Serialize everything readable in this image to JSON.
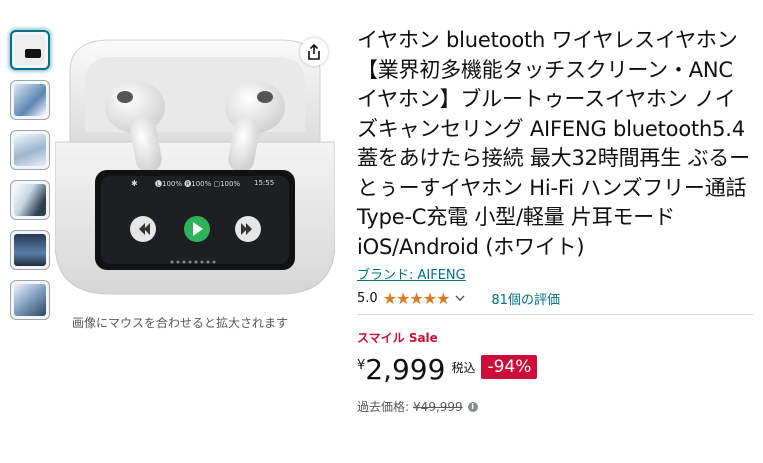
{
  "gallery": {
    "thumbnails": [
      "thumb-1",
      "thumb-2",
      "thumb-3",
      "thumb-4",
      "thumb-5",
      "thumb-6"
    ],
    "zoom_hint": "画像にマウスを合わせると拡大されます",
    "case_screen": {
      "bt_symbol": "✱",
      "status": "🅛100% 🅡100% ▢100%",
      "time": "15:55"
    }
  },
  "product": {
    "title": "イヤホン bluetooth ワイヤレスイヤホン【業界初多機能タッチスクリーン・ANC イヤホン】ブルートゥースイヤホン ノイズキャンセリング AIFENG bluetooth5.4 蓋をあけたら接続 最大32時間再生 ぶるーとぅーすイヤホン Hi-Fi ハンズフリー通話 Type-C充電 小型/軽量 片耳モード iOS/Android (ホワイト)",
    "brand": "ブランド: AIFENG",
    "rating_value": "5.0",
    "stars": "★★★★★",
    "reviews": "81個の評価"
  },
  "pricing": {
    "sale_label": "スマイル Sale",
    "currency": "¥",
    "price": "2,999",
    "tax": "税込",
    "discount": "-94%",
    "was_label": "過去価格:",
    "was_price": "¥49,999",
    "info": "i"
  },
  "colors": {
    "link": "#007185",
    "sale": "#cc0c39",
    "stars": "#de7921"
  }
}
